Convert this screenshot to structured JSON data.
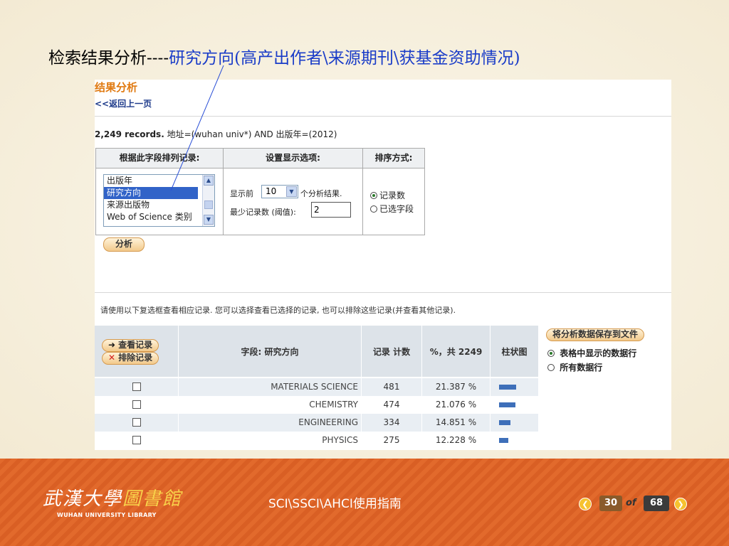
{
  "slide": {
    "title_prefix": "检索结果分析----",
    "title_highlight": "研究方向(高产出作者\\来源期刊\\获基金资助情况)"
  },
  "panel": {
    "heading": "结果分析",
    "back_link": "<<返回上一页",
    "record_count": "2,249 records.",
    "query": "地址=(wuhan univ*) AND 出版年=(2012)"
  },
  "options": {
    "col1_header": "根据此字段排列记录:",
    "col2_header": "设置显示选项:",
    "col3_header": "排序方式:",
    "field_list": [
      {
        "label": "出版年",
        "selected": false
      },
      {
        "label": "研究方向",
        "selected": true
      },
      {
        "label": "来源出版物",
        "selected": false
      },
      {
        "label": "Web of Science 类别",
        "selected": false
      }
    ],
    "show_top_label": "显示前",
    "show_top_value": "10",
    "show_top_suffix": "个分析结果.",
    "min_records_label": "最少记录数 (阈值):",
    "min_records_value": "2",
    "sort_options": [
      {
        "label": "记录数",
        "checked": true
      },
      {
        "label": "已选字段",
        "checked": false
      }
    ],
    "analyze_button": "分析"
  },
  "instructions": "请使用以下复选框查看相应记录. 您可以选择查看已选择的记录, 也可以排除这些记录(并查看其他记录).",
  "results": {
    "view_button": "查看记录",
    "exclude_button": "排除记录",
    "col_field": "字段: 研究方向",
    "col_count": "记录 计数",
    "col_pct": "%，共 2249",
    "col_bar": "柱状图",
    "save_button": "将分析数据保存到文件",
    "save_options": [
      {
        "label": "表格中显示的数据行",
        "checked": true
      },
      {
        "label": "所有数据行",
        "checked": false
      }
    ],
    "rows": [
      {
        "field": "MATERIALS SCIENCE",
        "count": "481",
        "pct": "21.387 %",
        "pct_value": 21.387
      },
      {
        "field": "CHEMISTRY",
        "count": "474",
        "pct": "21.076 %",
        "pct_value": 21.076
      },
      {
        "field": "ENGINEERING",
        "count": "334",
        "pct": "14.851 %",
        "pct_value": 14.851
      },
      {
        "field": "PHYSICS",
        "count": "275",
        "pct": "12.228 %",
        "pct_value": 12.228
      }
    ]
  },
  "footer": {
    "logo_cn_a": "武漢大學",
    "logo_cn_b": "圖書館",
    "logo_en": "WUHAN UNIVERSITY LIBRARY",
    "title": "SCI\\SSCI\\AHCI使用指南",
    "current_page": "30",
    "of_label": "of",
    "total_pages": "68"
  },
  "colors": {
    "accent_orange": "#e07a12",
    "link_blue": "#1a3cc8",
    "bar_blue": "#3e6fb9",
    "footer_orange": "#e26a2c"
  }
}
